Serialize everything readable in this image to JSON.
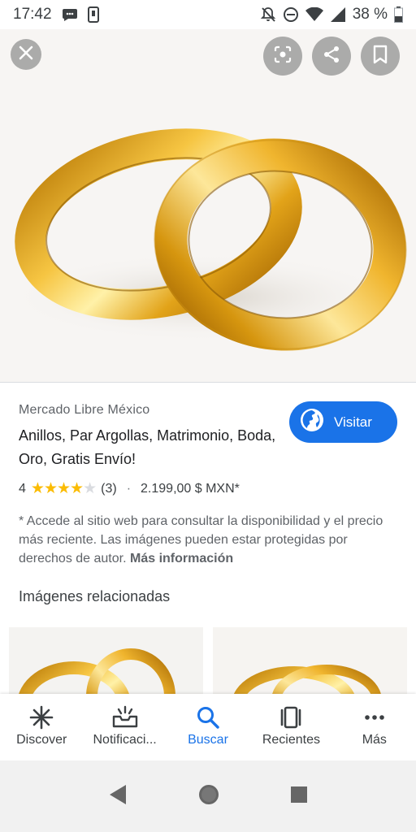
{
  "status_bar": {
    "time": "17:42",
    "battery": "38 %",
    "icons": [
      "chat-bubble-icon",
      "sim-icon",
      "notifications-off-icon",
      "dnd-icon",
      "wifi-icon",
      "signal-icon",
      "battery-icon"
    ]
  },
  "hero": {
    "actions": [
      "close-icon",
      "lens-icon",
      "share-icon",
      "bookmark-icon"
    ]
  },
  "result": {
    "source": "Mercado Libre México",
    "title": "Anillos, Par Argollas, Matrimonio, Boda, Oro, Gratis Envío!",
    "visit_label": "Visitar",
    "rating_value": "4",
    "rating_stars": 4,
    "rating_count": "(3)",
    "separator": "·",
    "price": "2.199,00 $ MXN*",
    "disclaimer": "* Accede al sitio web para consultar la disponibilidad y el precio más reciente. Las imágenes pueden estar protegidas por derechos de autor.",
    "more_info": "Más información"
  },
  "related": {
    "title": "Imágenes relacionadas"
  },
  "bottom_nav": {
    "items": [
      {
        "label": "Discover",
        "icon": "discover-icon",
        "active": false
      },
      {
        "label": "Notificaci...",
        "icon": "notifications-icon",
        "active": false
      },
      {
        "label": "Buscar",
        "icon": "search-icon",
        "active": true
      },
      {
        "label": "Recientes",
        "icon": "recents-icon",
        "active": false
      },
      {
        "label": "Más",
        "icon": "more-icon",
        "active": false
      }
    ]
  },
  "colors": {
    "accent": "#1a73e8",
    "star": "#fbbc04",
    "gold": "#e0a21c"
  }
}
